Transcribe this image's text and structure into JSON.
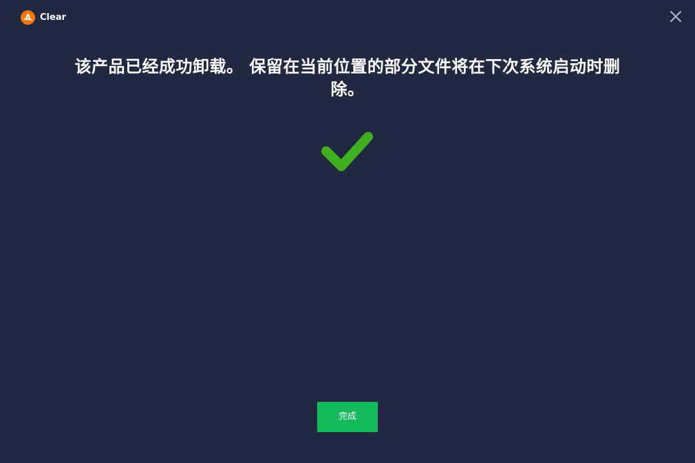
{
  "app": {
    "name": "Clear",
    "logo_icon": "avast-logo-icon",
    "brand_color": "#ff7800"
  },
  "titlebar": {
    "close_icon": "close-icon"
  },
  "main": {
    "message": "该产品已经成功卸载。 保留在当前位置的部分文件将在下次系统启动时删除。",
    "status_icon": "checkmark-icon",
    "status_color": "#3fae1f"
  },
  "footer": {
    "finish_label": "完成",
    "finish_color": "#13b95b"
  },
  "theme": {
    "background": "#212841",
    "text": "#ffffff"
  }
}
